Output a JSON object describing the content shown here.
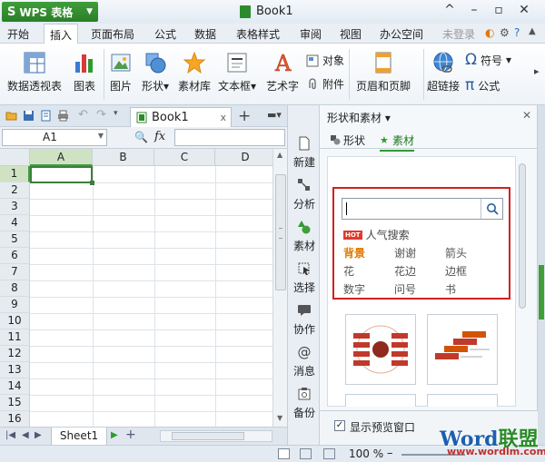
{
  "app": {
    "name": "WPS 表格",
    "logo": "S",
    "doc_title": "Book1"
  },
  "window_controls": [
    "^",
    "–",
    "▫",
    "✕"
  ],
  "menu": {
    "items": [
      "开始",
      "插入",
      "页面布局",
      "公式",
      "数据",
      "表格样式",
      "审阅",
      "视图",
      "办公空间"
    ],
    "active": "插入",
    "login": "未登录"
  },
  "ribbon": {
    "big": [
      "数据透视表",
      "图表",
      "图片",
      "形状",
      "素材库",
      "文本框",
      "艺术字"
    ],
    "small": {
      "object": "对象",
      "attach": "附件",
      "header_footer": "页眉和页脚",
      "hyperlink": "超链接",
      "symbol": "符号",
      "formula": "公式"
    },
    "dropdown_marks": {
      "shape": "▾",
      "textbox": "▾",
      "symbol": "▾"
    }
  },
  "doc_tab": {
    "label": "Book1",
    "close": "x",
    "new_tab": "+"
  },
  "formula_bar": {
    "cell_ref": "A1",
    "fx": "fx",
    "magnifier": "🔍"
  },
  "grid": {
    "columns": [
      "A",
      "B",
      "C",
      "D"
    ],
    "rows": [
      "1",
      "2",
      "3",
      "4",
      "5",
      "6",
      "7",
      "8",
      "9",
      "10",
      "11",
      "12",
      "13",
      "14",
      "15",
      "16"
    ],
    "selected_col": "A",
    "selected_row": "1"
  },
  "sheets": {
    "active": "Sheet1",
    "add": "+"
  },
  "status": {
    "zoom": "100 %",
    "zoom_minus": "–"
  },
  "side_toolbar": [
    "新建",
    "分析",
    "素材",
    "选择",
    "协作",
    "消息",
    "备份"
  ],
  "task_pane": {
    "title": "形状和素材",
    "title_caret": "▾",
    "close": "✕",
    "tabs": [
      "形状",
      "素材"
    ],
    "active_tab": "素材",
    "hot_badge": "HOT",
    "hot_label": "人气搜索",
    "keywords": [
      "背景",
      "谢谢",
      "箭头",
      "花",
      "花边",
      "边框",
      "数字",
      "问号",
      "书"
    ],
    "highlighted_keyword": "背景",
    "preview_label": "显示预览窗口",
    "preview_checked": true
  },
  "watermark": {
    "word": "Word",
    "cn": "联盟",
    "url": "www.wordlm.com"
  },
  "colors": {
    "brand_green": "#2a7f27",
    "highlight_red": "#d02020",
    "keyword_orange": "#e07a00",
    "selection_green": "#3e9d3e"
  }
}
